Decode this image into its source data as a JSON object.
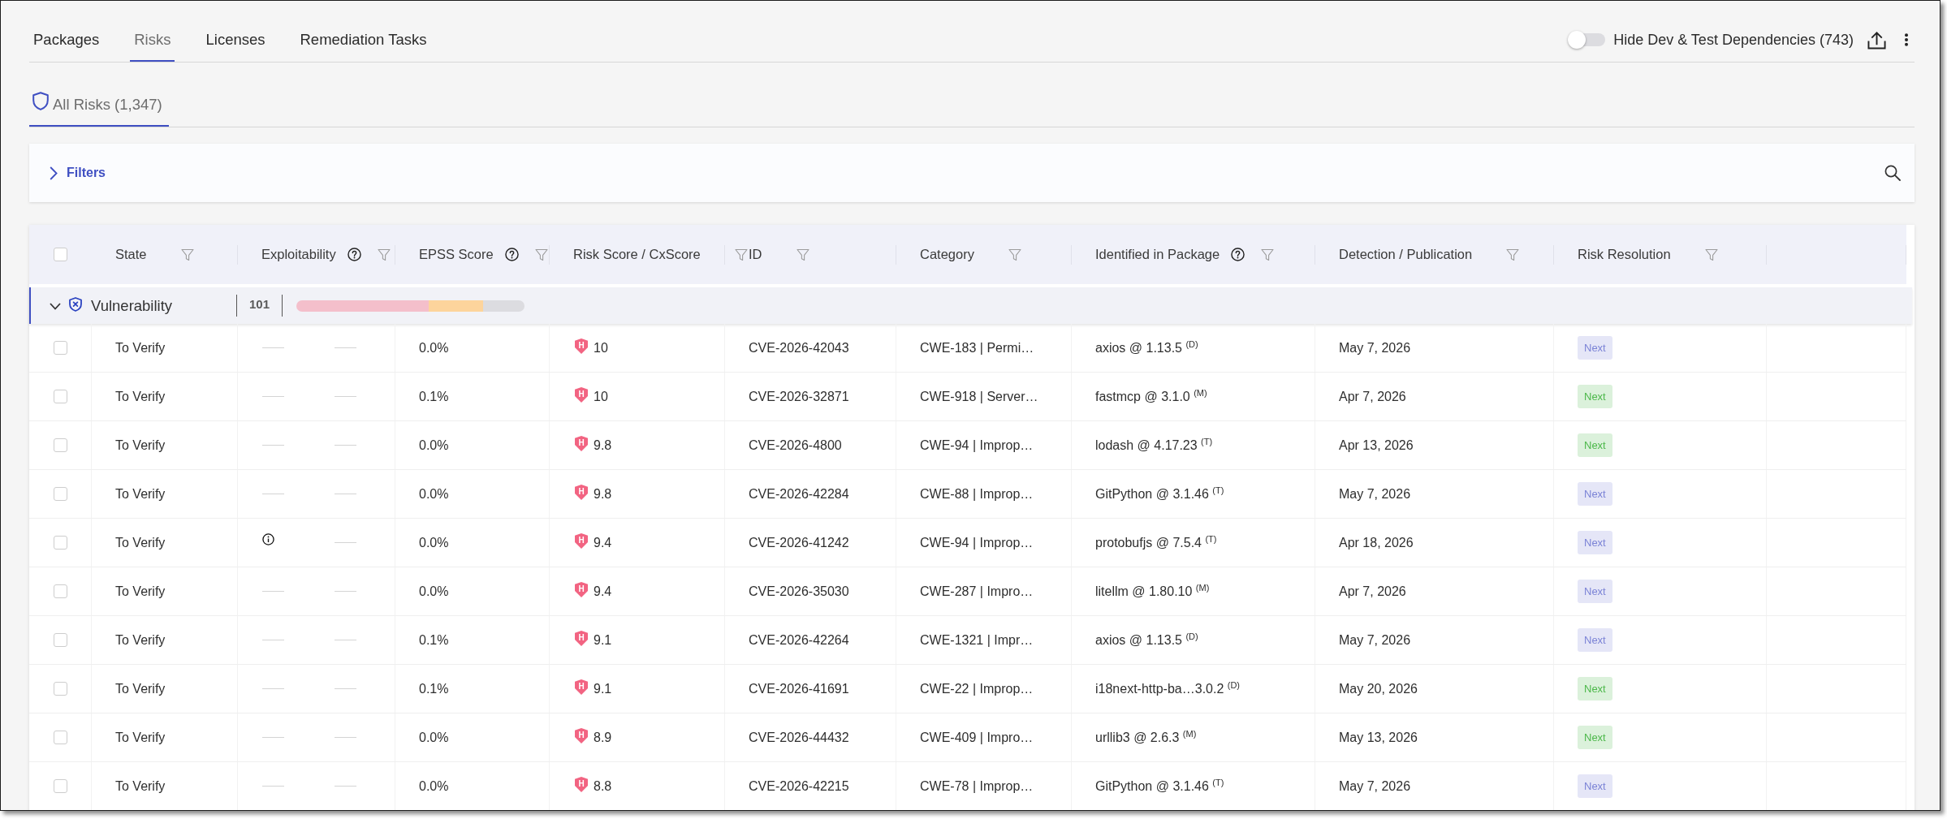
{
  "tabs": [
    {
      "label": "Packages",
      "selected": false
    },
    {
      "label": "Risks",
      "selected": true
    },
    {
      "label": "Licenses",
      "selected": false
    },
    {
      "label": "Remediation Tasks",
      "selected": false
    }
  ],
  "toolbar": {
    "toggle": {
      "label": "Hide Dev & Test Dependencies (743)",
      "on": false
    }
  },
  "subtabs": [
    {
      "label": "All Risks (1,347)",
      "selected": true
    }
  ],
  "filters": {
    "label": "Filters",
    "expanded": false
  },
  "table": {
    "select_all": {
      "checked": false
    },
    "columns": [
      {
        "label": "State",
        "help": false,
        "filter": true
      },
      {
        "label": "Exploitability",
        "help": true,
        "filter": true
      },
      {
        "label": "EPSS Score",
        "help": true,
        "filter": true
      },
      {
        "label": "Risk Score / CxScore",
        "help": false,
        "filter": true
      },
      {
        "label": "ID",
        "help": false,
        "filter": true
      },
      {
        "label": "Category",
        "help": false,
        "filter": true
      },
      {
        "label": "Identified in Package",
        "help": true,
        "filter": true
      },
      {
        "label": "Detection / Publication",
        "help": false,
        "filter": true
      },
      {
        "label": "Risk Resolution",
        "help": false,
        "filter": true
      }
    ],
    "group": {
      "label": "Vulnerability",
      "expanded": true,
      "count": "101"
    },
    "rows": [
      {
        "checked": false,
        "state": "To Verify",
        "exploitability": [
          {
            "kind": "none"
          },
          {
            "kind": "none"
          }
        ],
        "epss": "0.0%",
        "severity": "H",
        "risk_score": "10",
        "id": "CVE-2026-42043",
        "category": "CWE-183 | Permi…",
        "package": "axios @ 1.13.5 $^{(D)}$",
        "detection": "May 7, 2026",
        "resolution": {
          "label": "Next",
          "color": "#7b83d6"
        }
      },
      {
        "checked": false,
        "state": "To Verify",
        "exploitability": [
          {
            "kind": "none"
          },
          {
            "kind": "none"
          }
        ],
        "epss": "0.1%",
        "severity": "H",
        "risk_score": "10",
        "id": "CVE-2026-32871",
        "category": "CWE-918 | Server…",
        "package": "fastmcp @ 3.1.0 $^{(M)}$",
        "detection": "Apr 7, 2026",
        "resolution": {
          "label": "Next",
          "color": "#4cb84a"
        }
      },
      {
        "checked": false,
        "state": "To Verify",
        "exploitability": [
          {
            "kind": "none"
          },
          {
            "kind": "none"
          }
        ],
        "epss": "0.0%",
        "severity": "H",
        "risk_score": "9.8",
        "id": "CVE-2026-4800",
        "category": "CWE-94 | Improp…",
        "package": "lodash @ 4.17.23 $^{(T)}$",
        "detection": "Apr 13, 2026",
        "resolution": {
          "label": "Next",
          "color": "#4cb84a"
        }
      },
      {
        "checked": false,
        "state": "To Verify",
        "exploitability": [
          {
            "kind": "none"
          },
          {
            "kind": "none"
          }
        ],
        "epss": "0.0%",
        "severity": "H",
        "risk_score": "9.8",
        "id": "CVE-2026-42284",
        "category": "CWE-88 | Improp…",
        "package": "GitPython @ 3.1.46 $^{(T)}$",
        "detection": "May 7, 2026",
        "resolution": {
          "label": "Next",
          "color": "#7b83d6"
        }
      },
      {
        "checked": false,
        "state": "To Verify",
        "exploitability": [
          {
            "kind": "info"
          },
          {
            "kind": "none"
          }
        ],
        "epss": "0.0%",
        "severity": "H",
        "risk_score": "9.4",
        "id": "CVE-2026-41242",
        "category": "CWE-94 | Improp…",
        "package": "protobufjs @ 7.5.4 $^{(T)}$",
        "detection": "Apr 18, 2026",
        "resolution": {
          "label": "Next",
          "color": "#7b83d6"
        }
      },
      {
        "checked": false,
        "state": "To Verify",
        "exploitability": [
          {
            "kind": "none"
          },
          {
            "kind": "none"
          }
        ],
        "epss": "0.0%",
        "severity": "H",
        "risk_score": "9.4",
        "id": "CVE-2026-35030",
        "category": "CWE-287 | Impro…",
        "package": "litellm @ 1.80.10 $^{(M)}$",
        "detection": "Apr 7, 2026",
        "resolution": {
          "label": "Next",
          "color": "#7b83d6"
        }
      },
      {
        "checked": false,
        "state": "To Verify",
        "exploitability": [
          {
            "kind": "none"
          },
          {
            "kind": "none"
          }
        ],
        "epss": "0.1%",
        "severity": "H",
        "risk_score": "9.1",
        "id": "CVE-2026-42264",
        "category": "CWE-1321 | Impr…",
        "package": "axios @ 1.13.5 $^{(D)}$",
        "detection": "May 7, 2026",
        "resolution": {
          "label": "Next",
          "color": "#7b83d6"
        }
      },
      {
        "checked": false,
        "state": "To Verify",
        "exploitability": [
          {
            "kind": "none"
          },
          {
            "kind": "none"
          }
        ],
        "epss": "0.1%",
        "severity": "H",
        "risk_score": "9.1",
        "id": "CVE-2026-41691",
        "category": "CWE-22 | Improp…",
        "package": "i18next-http-ba…3.0.2 $^{(D)}$",
        "detection": "May 20, 2026",
        "resolution": {
          "label": "Next",
          "color": "#4cb84a"
        }
      },
      {
        "checked": false,
        "state": "To Verify",
        "exploitability": [
          {
            "kind": "none"
          },
          {
            "kind": "none"
          }
        ],
        "epss": "0.0%",
        "severity": "H",
        "risk_score": "8.9",
        "id": "CVE-2026-44432",
        "category": "CWE-409 | Impro…",
        "package": "urllib3 @ 2.6.3 $^{(M)}$",
        "detection": "May 13, 2026",
        "resolution": {
          "label": "Next",
          "color": "#4cb84a"
        }
      },
      {
        "checked": false,
        "state": "To Verify",
        "exploitability": [
          {
            "kind": "none"
          },
          {
            "kind": "none"
          }
        ],
        "epss": "0.0%",
        "severity": "H",
        "risk_score": "8.8",
        "id": "CVE-2026-42215",
        "category": "CWE-78 | Improp…",
        "package": "GitPython @ 3.1.46 $^{(T)}$",
        "detection": "May 7, 2026",
        "resolution": {
          "label": "Next",
          "color": "#7b83d6"
        }
      }
    ]
  }
}
